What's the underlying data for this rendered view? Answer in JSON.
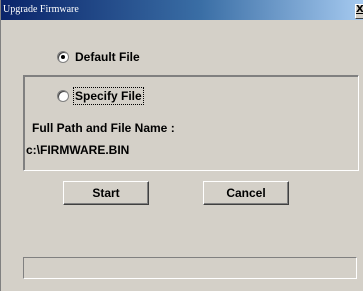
{
  "window": {
    "title": "Upgrade Firmware",
    "close_label": "X"
  },
  "options": {
    "default_file": {
      "label": "Default File",
      "checked": true
    },
    "specify_file": {
      "label": "Specify File",
      "checked": false
    }
  },
  "path": {
    "label": "Full Path and File Name :",
    "value": "c:\\FIRMWARE.BIN"
  },
  "buttons": {
    "start": "Start",
    "cancel": "Cancel"
  },
  "status": {
    "text": ""
  }
}
